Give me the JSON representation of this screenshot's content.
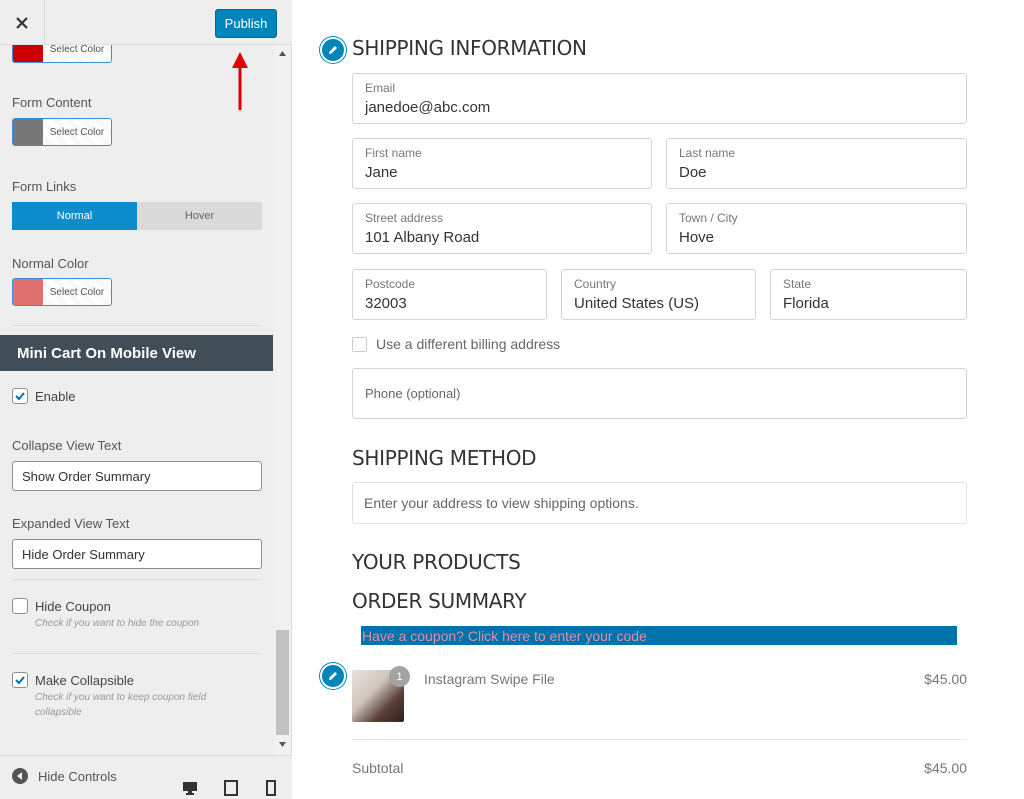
{
  "header": {
    "close_icon": "close-icon",
    "publish_label": "Publish"
  },
  "sidebar": {
    "top_color_picker": {
      "label": "Select Color",
      "color": "#cc0000"
    },
    "form_content": {
      "label": "Form Content",
      "picker_label": "Select Color",
      "color": "#777777"
    },
    "form_links": {
      "label": "Form Links",
      "tabs": [
        "Normal",
        "Hover"
      ],
      "active": "Normal"
    },
    "normal_color": {
      "label": "Normal Color",
      "picker_label": "Select Color",
      "color": "#e07070"
    },
    "section_title": "Mini Cart On Mobile View",
    "enable": {
      "label": "Enable",
      "checked": true
    },
    "collapse_view": {
      "label": "Collapse View Text",
      "value": "Show Order Summary"
    },
    "expanded_view": {
      "label": "Expanded View Text",
      "value": "Hide Order Summary"
    },
    "hide_coupon": {
      "label": "Hide Coupon",
      "hint": "Check if you want to hide the coupon",
      "checked": false
    },
    "make_collapsible": {
      "label": "Make Collapsible",
      "hint": "Check if you want to keep coupon field collapsible",
      "checked": true
    },
    "footer": {
      "hide_controls": "Hide Controls",
      "devices": [
        "desktop-icon",
        "tablet-icon",
        "mobile-icon"
      ]
    }
  },
  "preview": {
    "shipping_title": "SHIPPING INFORMATION",
    "fields": {
      "email": {
        "label": "Email",
        "value": "janedoe@abc.com"
      },
      "first_name": {
        "label": "First name",
        "value": "Jane"
      },
      "last_name": {
        "label": "Last name",
        "value": "Doe"
      },
      "street": {
        "label": "Street address",
        "value": "101 Albany Road"
      },
      "city": {
        "label": "Town / City",
        "value": "Hove"
      },
      "postcode": {
        "label": "Postcode",
        "value": "32003"
      },
      "country": {
        "label": "Country",
        "value": "United States (US)"
      },
      "state": {
        "label": "State",
        "value": "Florida"
      },
      "phone": {
        "placeholder": "Phone (optional)"
      }
    },
    "billing_checkbox": "Use a different billing address",
    "shipping_method_title": "SHIPPING METHOD",
    "shipping_method_msg": "Enter your address to view shipping options.",
    "products_title": "YOUR PRODUCTS",
    "order_summary_title": "ORDER SUMMARY",
    "coupon_text": "Have a coupon? Click here to enter your code",
    "product": {
      "name": "Instagram Swipe File",
      "qty": "1",
      "price": "$45.00"
    },
    "subtotal": {
      "label": "Subtotal",
      "value": "$45.00"
    }
  },
  "colors": {
    "accent": "#0085ba",
    "section_head": "#414d57",
    "coupon_bg": "#0073aa",
    "coupon_text": "#e58ba9"
  }
}
